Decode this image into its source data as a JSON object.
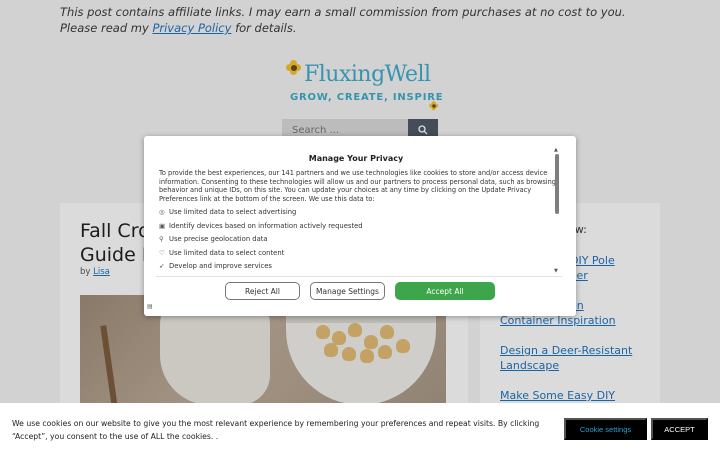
{
  "disclaimer": {
    "text": "This post contains affiliate links. I may earn a small commission from purchases at no cost to you. Please read my ",
    "link": "Privacy Policy",
    "suffix": " for details."
  },
  "logo": {
    "name": "FluxingWell",
    "tagline": "GROW, CREATE, INSPIRE",
    "color": "#3fa9c9"
  },
  "search": {
    "placeholder": "Search ...",
    "button_icon": "search-icon"
  },
  "post": {
    "title_line1": "Fall Cro",
    "title_line2": "Guide E",
    "by_label": "by",
    "author": "Lisa"
  },
  "sidebar": {
    "heading_fragment": "ow:",
    "links": [
      {
        "l1": "DIY Pole",
        "l2": "ver"
      },
      {
        "l1": "en",
        "l2": "Container Inspiration"
      },
      {
        "l1": "Design a Deer-Resistant",
        "l2": "Landscape"
      },
      {
        "l1": "Make Some Easy DIY",
        "l2": ""
      }
    ]
  },
  "privacy_modal": {
    "title": "Manage Your Privacy",
    "body": "To provide the best experiences, our 141 partners and we use technologies like cookies to store and/or access device information. Consenting to these technologies will allow us and our partners to process personal data, such as browsing behavior and unique IDs, on this site. You can update your choices at any time by clicking on the Update Privacy Preferences link at the bottom of the screen. We use this data to:",
    "purposes": [
      {
        "icon": "target-icon",
        "label": "Use limited data to select advertising"
      },
      {
        "icon": "device-id-icon",
        "label": "Identify devices based on information actively requested"
      },
      {
        "icon": "location-pin-icon",
        "label": "Use precise geolocation data"
      },
      {
        "icon": "heart-icon",
        "label": "Use limited data to select content"
      },
      {
        "icon": "rocket-icon",
        "label": "Develop and improve services"
      }
    ],
    "reject_label": "Reject All",
    "manage_label": "Manage Settings",
    "accept_label": "Accept All",
    "accept_color": "#3ea64a"
  },
  "cookie_banner": {
    "text": "We use cookies on our website to give you the most relevant experience by remembering your preferences and repeat visits. By clicking “Accept”, you consent to the use of ALL the cookies. .",
    "settings_label": "Cookie settings",
    "accept_label": "ACCEPT",
    "settings_color": "#2aa0d0"
  }
}
